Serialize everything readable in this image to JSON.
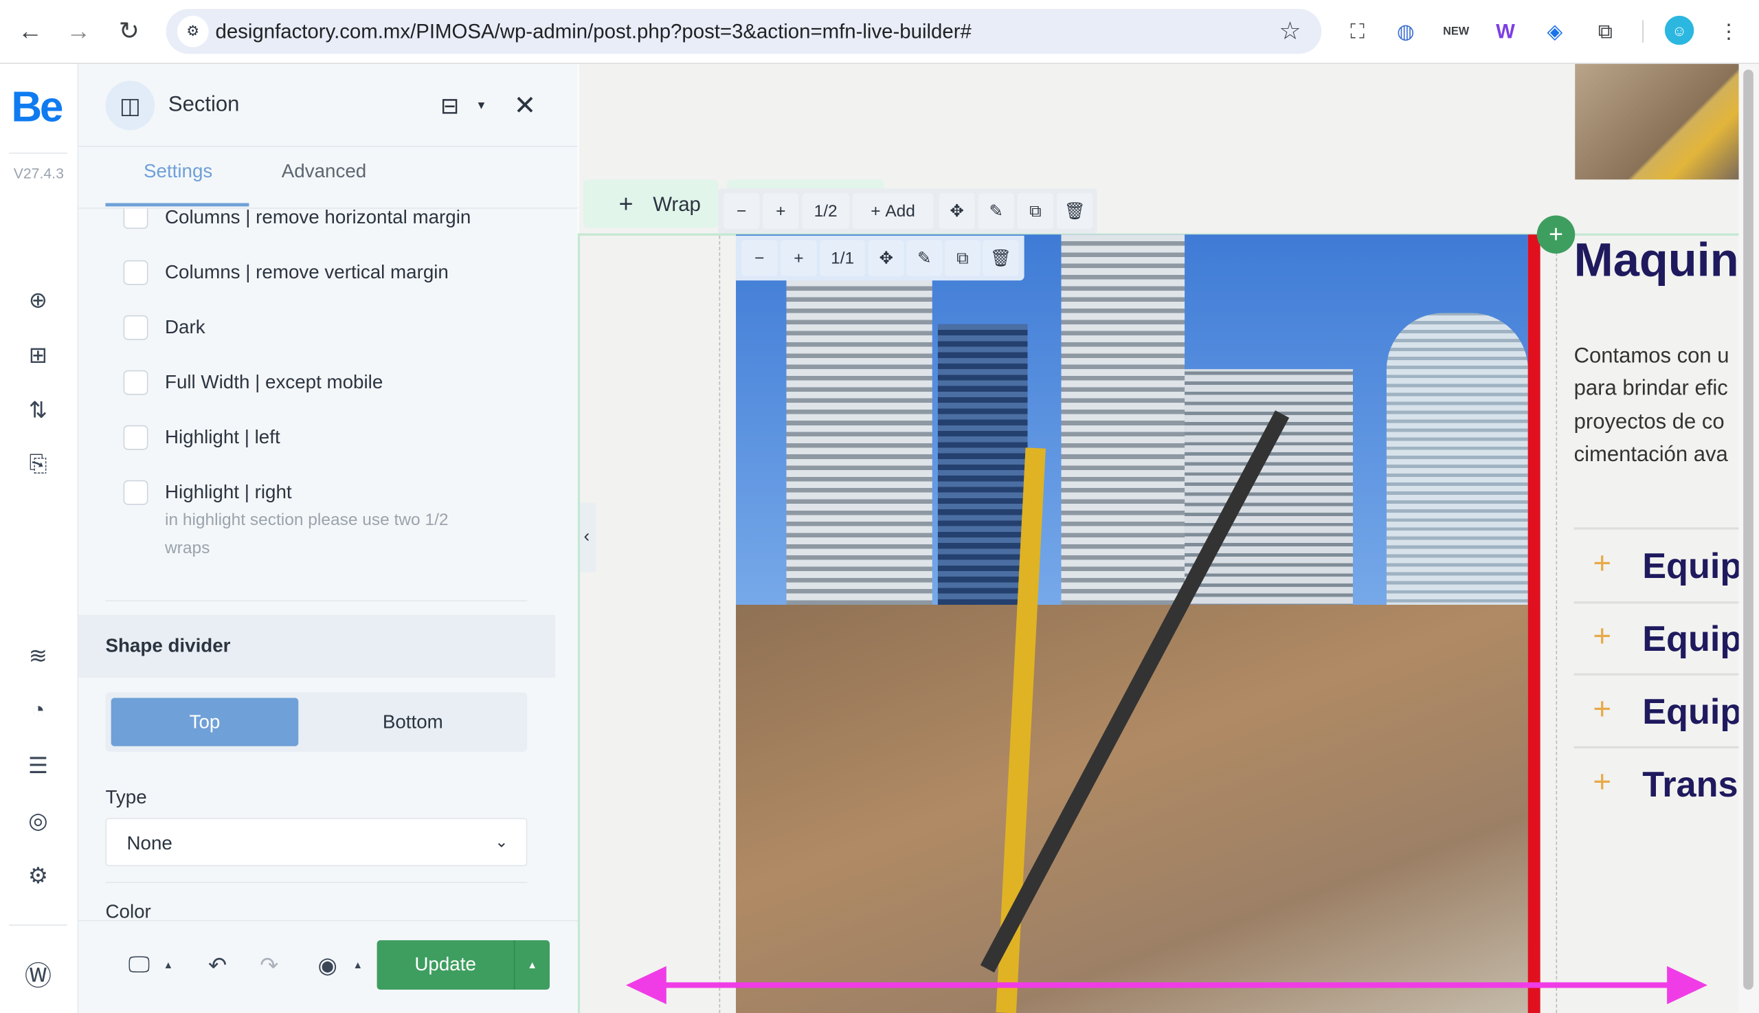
{
  "browser": {
    "url": "designfactory.com.mx/PIMOSA/wp-admin/post.php?post=3&action=mfn-live-builder#"
  },
  "rail": {
    "logo": "Be",
    "version": "V27.4.3"
  },
  "panel": {
    "title": "Section",
    "tabs": [
      {
        "label": "Settings",
        "active": true
      },
      {
        "label": "Advanced",
        "active": false
      }
    ],
    "options": [
      {
        "label": "Columns | remove horizontal margin",
        "checked": false
      },
      {
        "label": "Columns | remove vertical margin",
        "checked": false
      },
      {
        "label": "Dark",
        "checked": false
      },
      {
        "label": "Full Width | except mobile",
        "checked": false
      },
      {
        "label": "Highlight | left",
        "checked": false
      },
      {
        "label": "Highlight | right",
        "checked": false
      }
    ],
    "help_text_1": "in highlight section please use two 1/2",
    "help_text_2": "wraps",
    "shape_divider": {
      "title": "Shape divider",
      "segments": [
        "Top",
        "Bottom"
      ],
      "selected": "Top",
      "type_label": "Type",
      "type_value": "None",
      "color_label": "Color"
    },
    "footer": {
      "update_label": "Update"
    }
  },
  "canvas": {
    "wrap_label": "Wrap",
    "wrap_toolbar": {
      "size": "1/2",
      "add_label": "Add"
    },
    "column_toolbar": {
      "size": "1/1"
    },
    "heading": "Maquina",
    "paragraph": [
      "Contamos con u",
      "para brindar efic",
      "proyectos de co",
      "cimentación ava"
    ],
    "accordion": [
      "Equip",
      "Equip",
      "Equip",
      "Trans"
    ]
  },
  "colors": {
    "accent": "#6fa0d8",
    "update": "#3e9e5f",
    "heading": "#1f1a5e",
    "highlight": "#e0101f",
    "arrow": "#f03ce6"
  }
}
